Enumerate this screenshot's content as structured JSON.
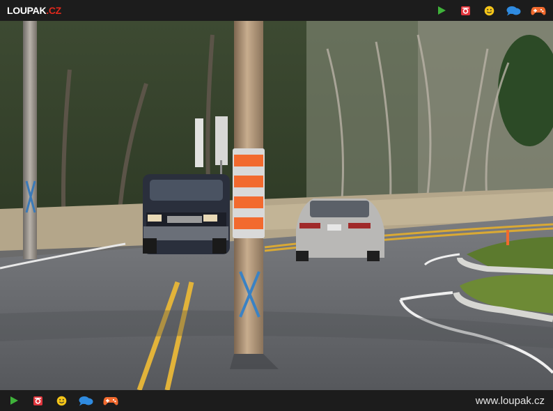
{
  "header": {
    "logo_main": "LOUPAK",
    "logo_dot": ".",
    "logo_tld": "CZ",
    "icons": [
      "play-icon",
      "instagram-icon",
      "smiley-icon",
      "chat-icon",
      "gamepad-icon"
    ]
  },
  "photo": {
    "sign_stripe_colors": [
      "#f26a2e",
      "#d9d9d9"
    ]
  },
  "footer": {
    "site_url": "www.loupak.cz",
    "icons": [
      "play-icon",
      "instagram-icon",
      "smiley-icon",
      "chat-icon",
      "gamepad-icon"
    ]
  },
  "colors": {
    "bar_bg": "#1c1c1c",
    "logo_accent": "#e0281c",
    "play": "#3fb23a",
    "instagram": "#e2363d",
    "smiley": "#f5c518",
    "chat": "#2f8be0",
    "gamepad": "#f26a2e"
  }
}
